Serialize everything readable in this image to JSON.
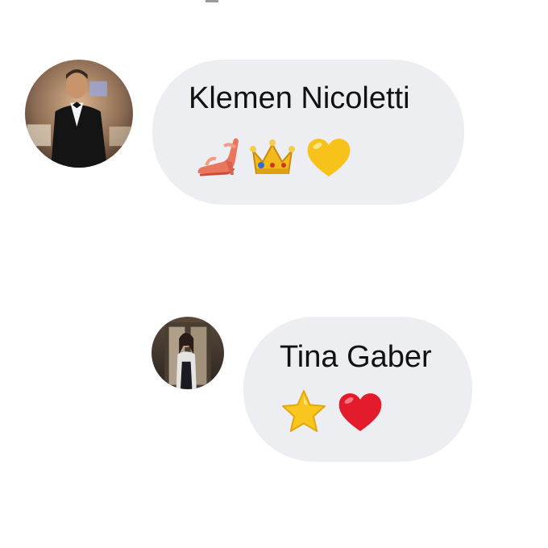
{
  "messages": [
    {
      "sender_name": "Klemen Nicoletti",
      "avatar_icon": "profile-photo-man-in-tuxedo",
      "emojis": [
        "sandal-icon",
        "crown-icon",
        "yellow-heart-icon"
      ]
    },
    {
      "sender_name": "Tina Gaber",
      "avatar_icon": "profile-photo-woman-in-doorway",
      "emojis": [
        "star-icon",
        "red-heart-icon"
      ]
    }
  ],
  "colors": {
    "bubble_background": "#edeef1",
    "text": "#111111",
    "page_background": "#ffffff"
  }
}
